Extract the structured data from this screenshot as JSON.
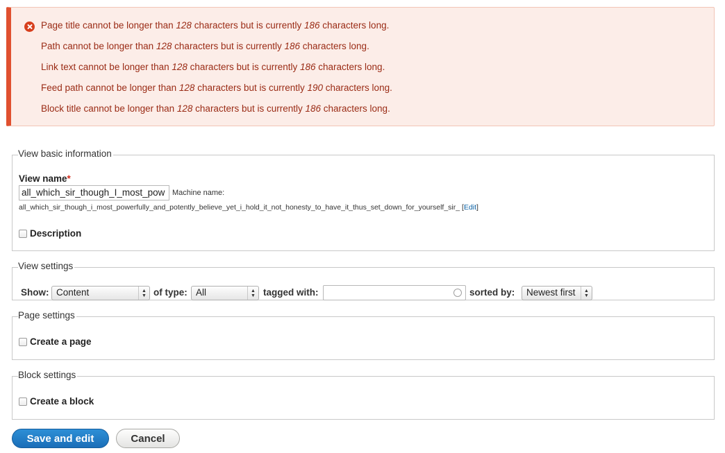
{
  "messages": [
    {
      "pre": "Page title cannot be longer than ",
      "max": "128",
      "mid": " characters but is currently ",
      "cur": "186",
      "post": " characters long."
    },
    {
      "pre": "Path cannot be longer than ",
      "max": "128",
      "mid": " characters but is currently ",
      "cur": "186",
      "post": " characters long."
    },
    {
      "pre": "Link text cannot be longer than ",
      "max": "128",
      "mid": " characters but is currently ",
      "cur": "186",
      "post": " characters long."
    },
    {
      "pre": "Feed path cannot be longer than ",
      "max": "128",
      "mid": " characters but is currently ",
      "cur": "190",
      "post": " characters long."
    },
    {
      "pre": "Block title cannot be longer than ",
      "max": "128",
      "mid": " characters but is currently ",
      "cur": "186",
      "post": " characters long."
    }
  ],
  "basic": {
    "legend": "View basic information",
    "view_name_label": "View name",
    "required_mark": "*",
    "view_name_value": "all_which_sir_though_I_most_pow",
    "machine_name_label": "Machine name:",
    "machine_name_value": "all_which_sir_though_i_most_powerfully_and_potently_believe_yet_i_hold_it_not_honesty_to_have_it_thus_set_down_for_yourself_sir_",
    "edit_open": "[",
    "edit_link": "Edit",
    "edit_close": "]",
    "description_label": "Description"
  },
  "view_settings": {
    "legend": "View settings",
    "show_label": "Show:",
    "show_value": "Content",
    "type_label": "of type:",
    "type_value": "All",
    "tagged_label": "tagged with:",
    "tagged_value": "",
    "sorted_label": "sorted by:",
    "sorted_value": "Newest first"
  },
  "page_settings": {
    "legend": "Page settings",
    "create_label": "Create a page"
  },
  "block_settings": {
    "legend": "Block settings",
    "create_label": "Create a block"
  },
  "actions": {
    "save_label": "Save and edit",
    "cancel_label": "Cancel"
  },
  "colors": {
    "error_accent": "#e0502f",
    "error_text": "#9a2b15",
    "primary_button": "#1a6eb8"
  }
}
